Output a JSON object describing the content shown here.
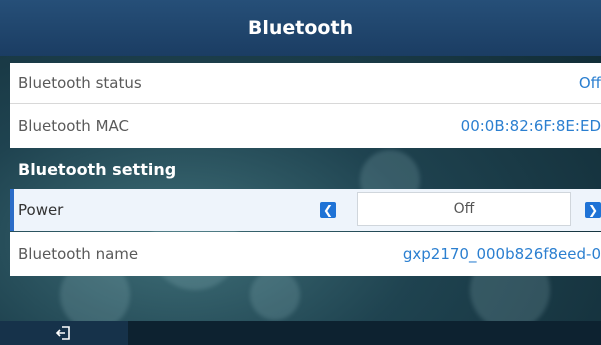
{
  "header": {
    "title": "Bluetooth"
  },
  "status_rows": [
    {
      "label": "Bluetooth status",
      "value": "Off"
    },
    {
      "label": "Bluetooth MAC",
      "value": "00:0B:82:6F:8E:ED"
    }
  ],
  "section": {
    "title": "Bluetooth setting"
  },
  "power": {
    "label": "Power",
    "selected": "Off"
  },
  "name_row": {
    "label": "Bluetooth name",
    "value": "gxp2170_000b826f8eed-0"
  },
  "icons": {
    "prev": "chevron-left-icon",
    "next": "chevron-right-icon",
    "back": "exit-icon"
  },
  "colors": {
    "title_bar": "#1b3d63",
    "accent": "#2b7fd0",
    "button": "#1f73d6"
  }
}
